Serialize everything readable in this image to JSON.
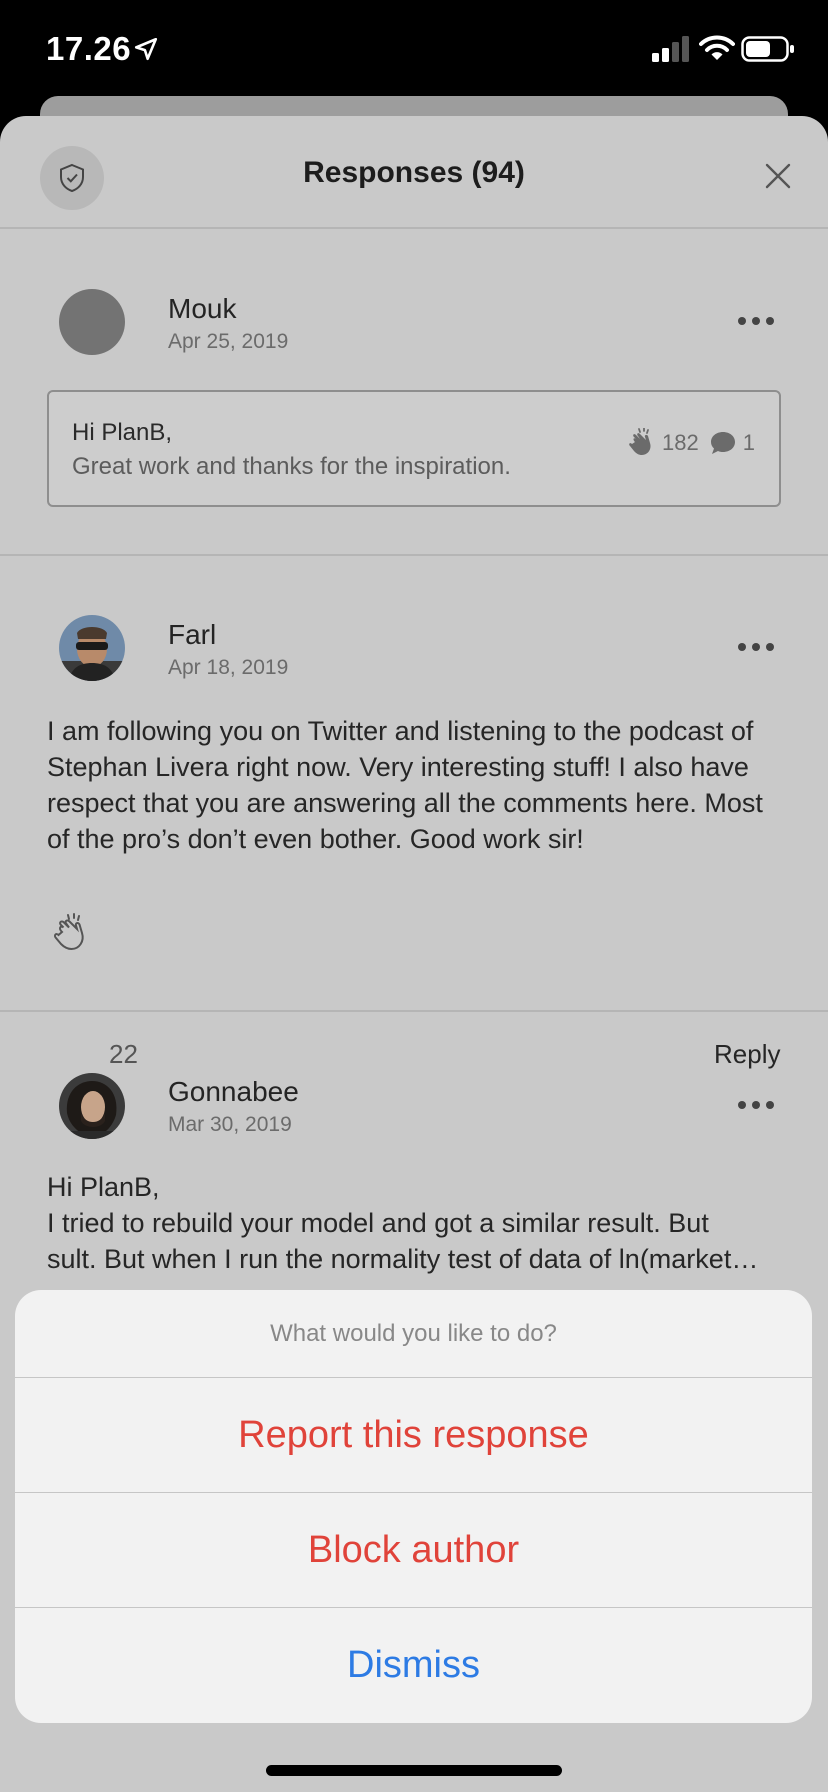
{
  "status_bar": {
    "time": "17.26"
  },
  "header": {
    "title": "Responses (94)"
  },
  "responses": [
    {
      "author": "Mouk",
      "date": "Apr 25, 2019",
      "quote_line1": "Hi PlanB,",
      "quote_line2": "Great work and thanks for the inspiration.",
      "claps": "182",
      "comments": "1"
    },
    {
      "author": "Farl",
      "date": "Apr 18, 2019",
      "body": "I am following you on Twitter and listening to the podcast of Stephan Livera right now. Very interesting stuff! I also have respect that you are answering all the comments here. Most of the pro’s don’t even bother. Good work sir!",
      "claps": "22",
      "reply_label": "Reply"
    },
    {
      "author": "Gonnabee",
      "date": "Mar 30, 2019",
      "body_line1": "Hi PlanB,",
      "body_line2": "I tried to rebuild your model and got a similar result. But",
      "body_line3": "sult. But when I run the normality test of data of ln(market…"
    }
  ],
  "action_sheet": {
    "title": "What would you like to do?",
    "report_label": "Report this response",
    "block_label": "Block author",
    "dismiss_label": "Dismiss",
    "destructive_color": "#e0433a",
    "default_color": "#2d7be4"
  }
}
